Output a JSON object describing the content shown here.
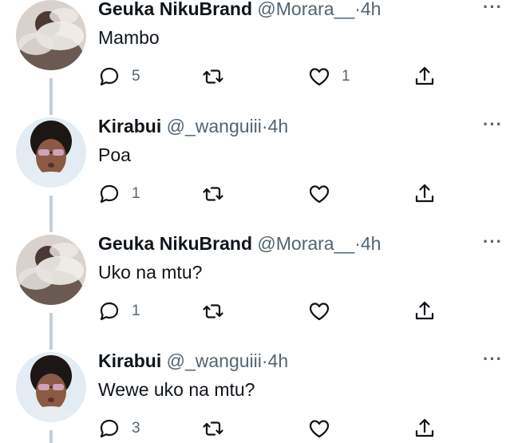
{
  "tweets": [
    {
      "name": "Geuka NikuBrand",
      "handle": "@Morara__",
      "separator": "·",
      "time": "4h",
      "text": "Mambo",
      "reply_count": "5",
      "retweet_count": "",
      "like_count": "1",
      "avatar_icon": "smoke-portrait-avatar"
    },
    {
      "name": "Kirabui",
      "handle": "@_wanguiii",
      "separator": "·",
      "time": "4h",
      "text": "Poa",
      "reply_count": "1",
      "retweet_count": "",
      "like_count": "",
      "avatar_icon": "sunglasses-portrait-avatar"
    },
    {
      "name": "Geuka NikuBrand",
      "handle": "@Morara__",
      "separator": "·",
      "time": "4h",
      "text": "Uko na mtu?",
      "reply_count": "1",
      "retweet_count": "",
      "like_count": "",
      "avatar_icon": "smoke-portrait-avatar"
    },
    {
      "name": "Kirabui",
      "handle": "@_wanguiii",
      "separator": "·",
      "time": "4h",
      "text": "Wewe uko na mtu?",
      "reply_count": "3",
      "retweet_count": "",
      "like_count": "",
      "avatar_icon": "sunglasses-portrait-avatar"
    }
  ],
  "more_icon": "···",
  "colors": {
    "text": "#0f1419",
    "muted": "#536471",
    "thread_line": "#c4cfd6"
  }
}
